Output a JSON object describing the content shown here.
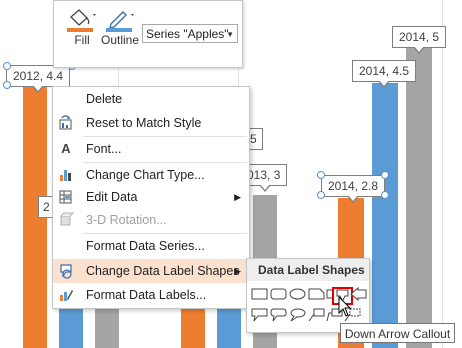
{
  "toolbar": {
    "fill_label": "Fill",
    "outline_label": "Outline",
    "series_selected": "Series \"Apples\""
  },
  "callouts": {
    "c2012_44": "2012, 4.4",
    "c2014_5": "2014, 5",
    "c2014_45": "2014, 4.5",
    "c2013_3": "013, 3",
    "c2014_28": "2014, 2.8",
    "partial_2": "2",
    "partial_5": "5"
  },
  "context_menu": {
    "items": [
      {
        "label": "Delete",
        "icon": "none"
      },
      {
        "label": "Reset to Match Style",
        "icon": "reset-style-icon"
      },
      {
        "label": "Font...",
        "icon": "font-icon"
      },
      {
        "label": "Change Chart Type...",
        "icon": "chart-type-icon"
      },
      {
        "label": "Edit Data",
        "icon": "edit-data-icon"
      },
      {
        "label": "3-D Rotation...",
        "icon": "3d-rotation-icon"
      },
      {
        "label": "Format Data Series...",
        "icon": "none"
      },
      {
        "label": "Change Data Label Shapes",
        "icon": "label-shapes-icon"
      },
      {
        "label": "Format Data Labels...",
        "icon": "format-labels-icon"
      }
    ]
  },
  "submenu": {
    "header": "Data Label Shapes"
  },
  "tooltip": "Down Arrow Callout",
  "colors": {
    "orange": "#ed7d31",
    "blue": "#5b9bd5",
    "gray": "#a5a5a5",
    "highlight": "#fde1cf",
    "selected_border": "#e00000"
  }
}
